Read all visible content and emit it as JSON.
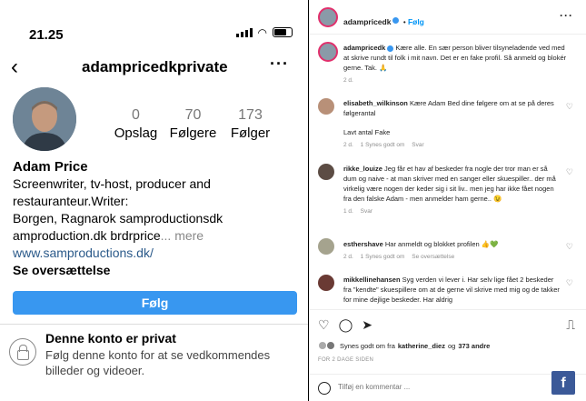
{
  "phone": {
    "time": "21.25",
    "username": "adampricedkprivate",
    "stats": [
      {
        "value": "0",
        "label": "Opslag"
      },
      {
        "value": "70",
        "label": "Følgere"
      },
      {
        "value": "173",
        "label": "Følger"
      }
    ],
    "bio": {
      "name": "Adam Price",
      "line1": "Screenwriter, tv-host, producer and",
      "line2": "restauranteur.Writer:",
      "line3": "Borgen, Ragnarok samproductionsdk",
      "line4": "amproduction.dk brdrprice",
      "more": "... mere",
      "link": "www.samproductions.dk/",
      "translate": "Se oversættelse"
    },
    "follow_label": "Følg",
    "private_title": "Denne konto er privat",
    "private_text": "Følg denne konto for at se vedkommendes billeder og videoer."
  },
  "post": {
    "author": "adampricedk",
    "follow_label": "Følg",
    "caption": "Kære alle. En sær person bliver tilsyneladende ved med at skrive rundt til folk i mit navn. Det er en fake profil. Så anmeld og blokér gerne. Tak. 🙏",
    "caption_age": "2 d.",
    "comments": [
      {
        "user": "elisabeth_wilkinson",
        "text": "Kære Adam Bed dine følgere om at se på deres følgerantal",
        "text2": "Lavt antal Fake",
        "age": "2 d.",
        "likes": "1 Synes godt om",
        "reply": "Svar"
      },
      {
        "user": "rikke_louize",
        "text": "Jeg får et hav af beskeder fra nogle der tror man er så dum og naive - at man skriver med en sanger eller skuespiller.. der må virkelig være nogen der keder sig i sit liv.. men jeg har ikke fået nogen fra den falske Adam - men anmelder ham gerne.. 😉",
        "age": "1 d.",
        "reply": "Svar"
      },
      {
        "user": "esthershave",
        "text": "Har anmeldt og blokket profilen 👍💚",
        "age": "2 d.",
        "likes": "1 Synes godt om",
        "reply": "Se oversættelse"
      },
      {
        "user": "mikkellinehansen",
        "text": "Syg verden vi lever i. Har selv lige fået 2 beskeder fra \"kendte\" skuespillere om at de gerne vil skrive med mig og de takker for mine dejlige beskeder. Har aldrig"
      }
    ],
    "likes_prefix": "Synes godt om fra",
    "likes_user": "katherine_diez",
    "likes_suffix": "og",
    "likes_count": "373 andre",
    "date": "FOR 2 DAGE SIDEN",
    "comment_placeholder": "Tilføj en kommentar ..."
  }
}
